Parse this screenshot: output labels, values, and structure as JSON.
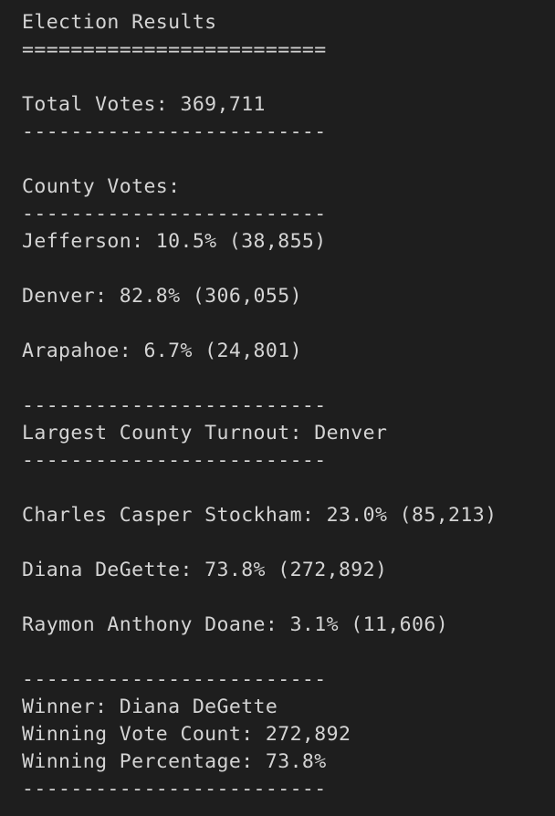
{
  "terminal_output": {
    "lines": [
      "Election Results",
      "=========================",
      "",
      "Total Votes: 369,711",
      "-------------------------",
      "",
      "County Votes:",
      "-------------------------",
      "Jefferson: 10.5% (38,855)",
      "",
      "Denver: 82.8% (306,055)",
      "",
      "Arapahoe: 6.7% (24,801)",
      "",
      "-------------------------",
      "Largest County Turnout: Denver",
      "-------------------------",
      "",
      "Charles Casper Stockham: 23.0% (85,213)",
      "",
      "Diana DeGette: 73.8% (272,892)",
      "",
      "Raymon Anthony Doane: 3.1% (11,606)",
      "",
      "-------------------------",
      "Winner: Diana DeGette",
      "Winning Vote Count: 272,892",
      "Winning Percentage: 73.8%",
      "-------------------------"
    ]
  }
}
